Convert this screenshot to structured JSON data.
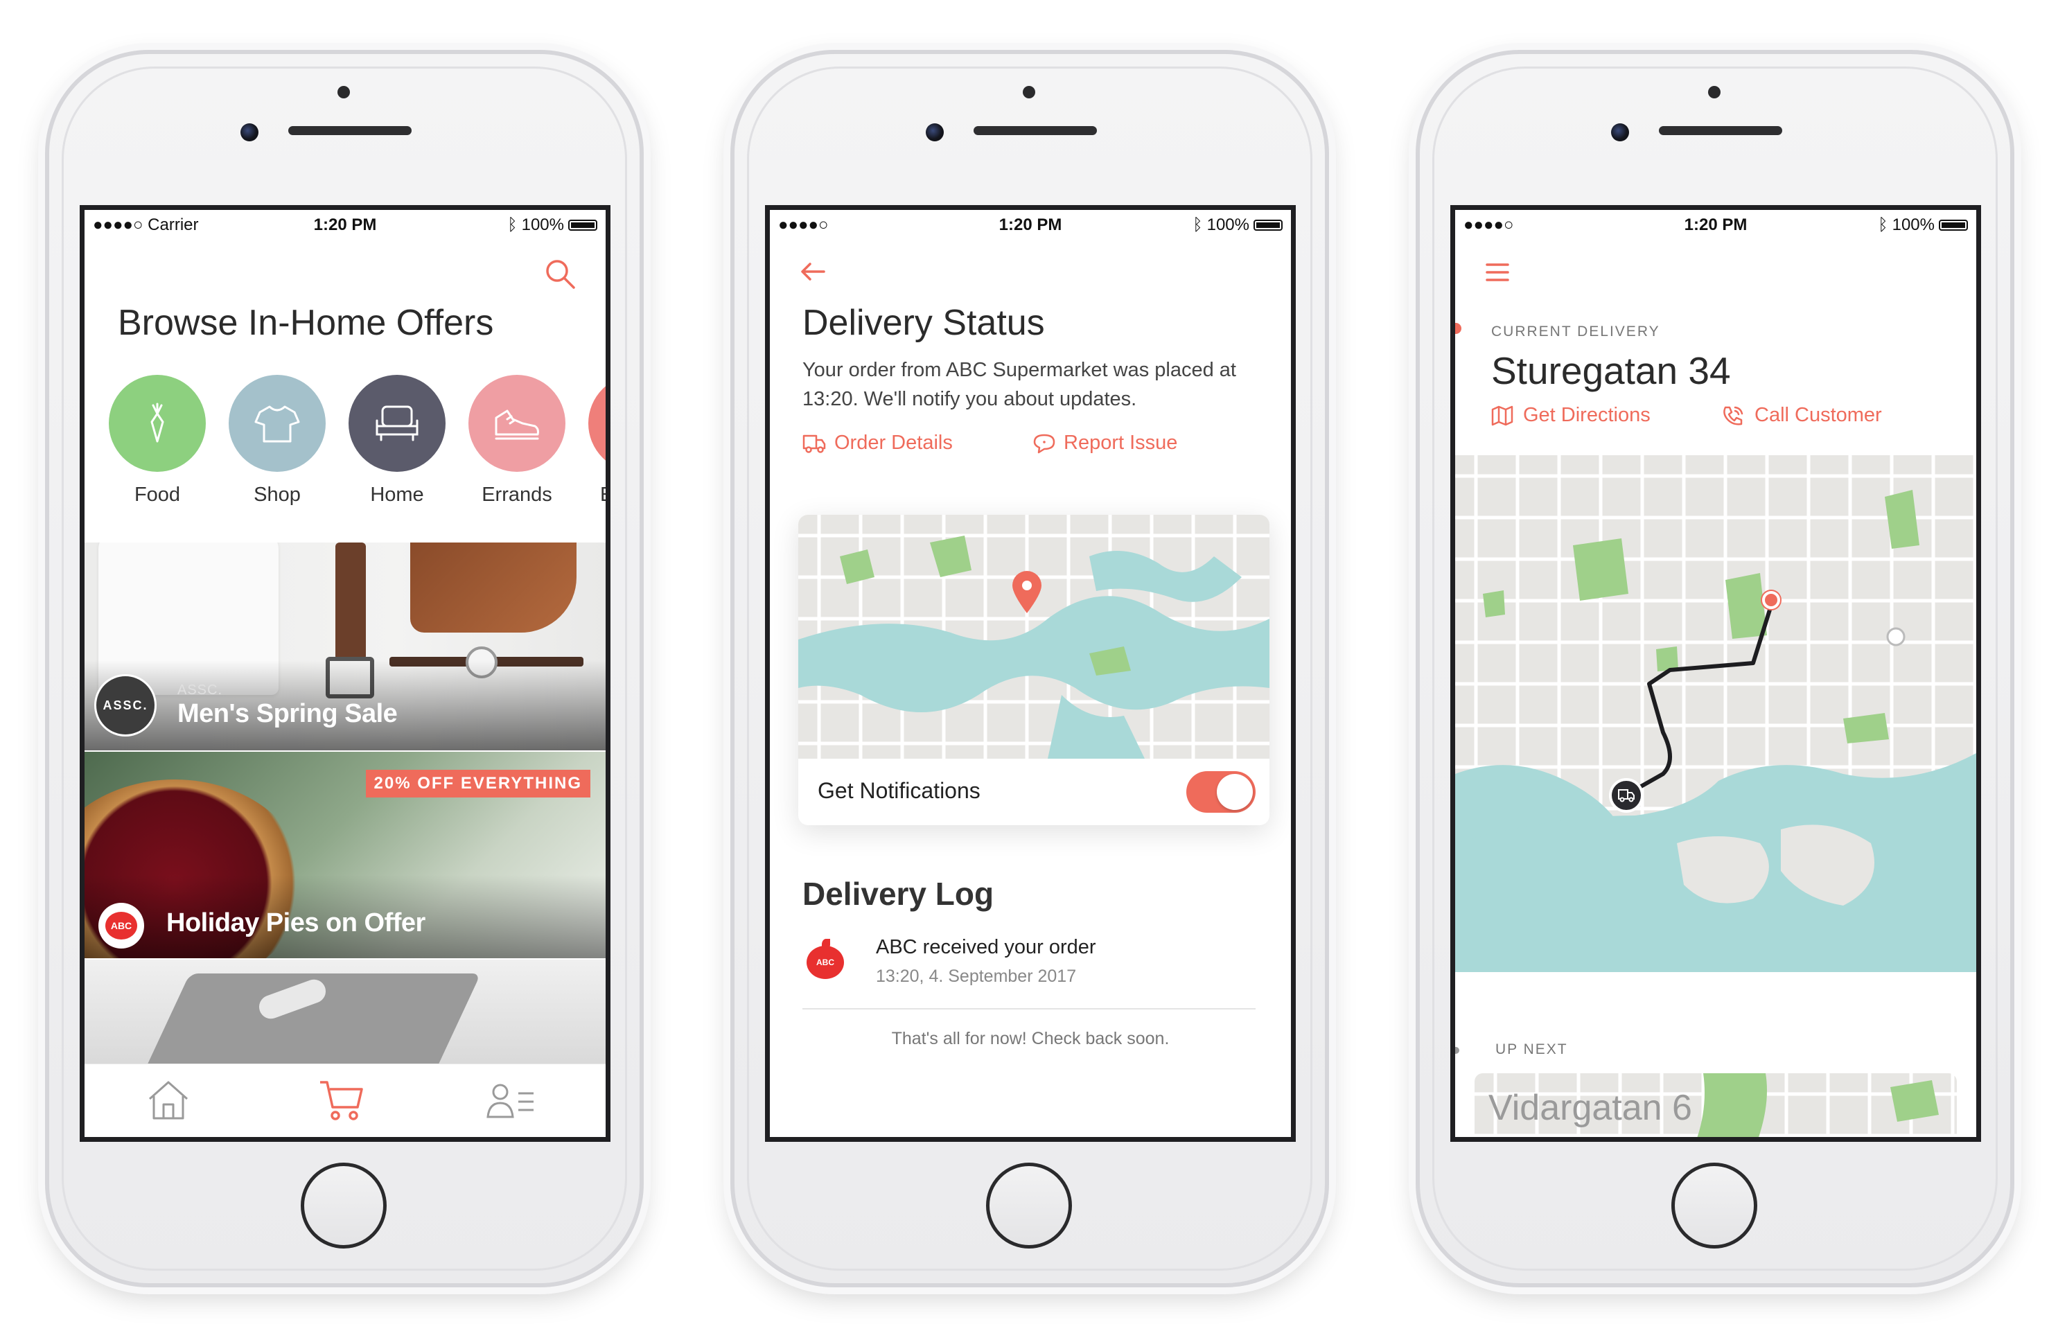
{
  "colors": {
    "accent": "#ef6b5b",
    "food": "#8dd07f",
    "shop": "#a4c1cb",
    "home": "#5b5b6b",
    "errands": "#ef9ea3",
    "water": "#a9d9d8",
    "park": "#9fd08a"
  },
  "phone1": {
    "status": {
      "carrier": "●●●●○ Carrier",
      "time": "1:20 PM",
      "battery": "100%"
    },
    "title": "Browse In-Home Offers",
    "categories": [
      {
        "label": "Food",
        "icon": "carrot-icon"
      },
      {
        "label": "Shop",
        "icon": "tshirt-icon"
      },
      {
        "label": "Home",
        "icon": "armchair-icon"
      },
      {
        "label": "Errands",
        "icon": "sneaker-icon"
      },
      {
        "label": "E",
        "icon": "category-icon"
      }
    ],
    "banners": [
      {
        "brand": "ASSC.",
        "badge_text": "ASSC.",
        "title": "Men's Spring Sale"
      },
      {
        "tag": "20% OFF EVERYTHING",
        "badge_text": "ABC",
        "title": "Holiday Pies on Offer"
      }
    ],
    "tabs": [
      "home-icon",
      "cart-icon",
      "profile-list-icon"
    ]
  },
  "phone2": {
    "status": {
      "carrier": "●●●●○",
      "time": "1:20 PM",
      "battery": "100%"
    },
    "title": "Delivery Status",
    "description": "Your order from ABC Supermarket was placed at 13:20. We'll notify you about updates.",
    "links": {
      "order_details": "Order Details",
      "report_issue": "Report Issue"
    },
    "notifications_label": "Get Notifications",
    "notifications_on": true,
    "log_title": "Delivery Log",
    "log_entry": {
      "logo": "ABC",
      "title": "ABC received your order",
      "time": "13:20, 4. September 2017"
    },
    "footer": "That's all for now! Check back soon."
  },
  "phone3": {
    "status": {
      "carrier": "●●●●○",
      "time": "1:20 PM",
      "battery": "100%"
    },
    "section_label": "CURRENT DELIVERY",
    "address": "Sturegatan 34",
    "actions": {
      "directions": "Get Directions",
      "call": "Call Customer"
    },
    "up_next_label": "UP NEXT",
    "next_address": "Vidargatan 6"
  }
}
